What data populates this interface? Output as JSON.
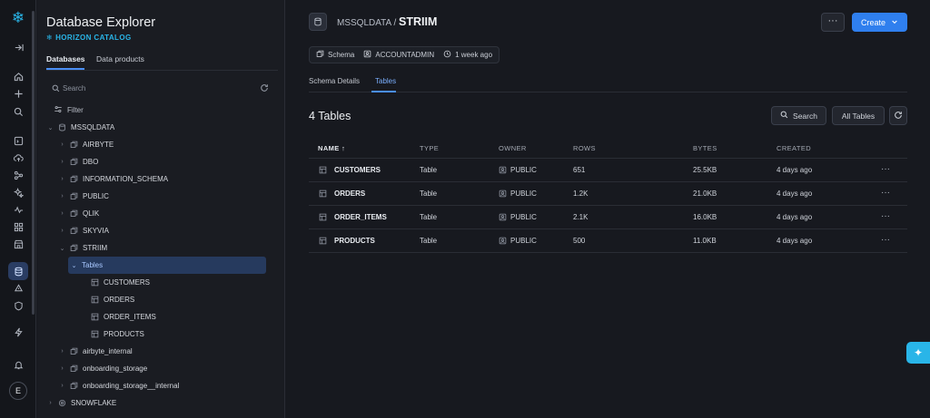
{
  "sidebar": {
    "title": "Database Explorer",
    "subtitle": "HORIZON CATALOG",
    "tabs": [
      "Databases",
      "Data products"
    ],
    "search_placeholder": "Search",
    "filter_label": "Filter",
    "tree": {
      "root": "MSSQLDATA",
      "schemas": [
        "AIRBYTE",
        "DBO",
        "INFORMATION_SCHEMA",
        "PUBLIC",
        "QLIK",
        "SKYVIA",
        "STRIIM"
      ],
      "tables_folder": "Tables",
      "tables": [
        "CUSTOMERS",
        "ORDERS",
        "ORDER_ITEMS",
        "PRODUCTS"
      ],
      "more_schemas": [
        "airbyte_internal",
        "onboarding_storage",
        "onboarding_storage__internal"
      ],
      "other_db": "SNOWFLAKE"
    }
  },
  "rail": {
    "avatar_initial": "E"
  },
  "header": {
    "db": "MSSQLDATA",
    "separator": "/",
    "schema": "STRIIM",
    "more_label": "···",
    "create_label": "Create"
  },
  "meta": {
    "type": "Schema",
    "owner": "ACCOUNTADMIN",
    "age": "1 week ago"
  },
  "tabs": [
    "Schema Details",
    "Tables"
  ],
  "table_section": {
    "count_title": "4 Tables",
    "search_label": "Search",
    "filter_label": "All Tables"
  },
  "columns": [
    "NAME",
    "TYPE",
    "OWNER",
    "ROWS",
    "BYTES",
    "CREATED"
  ],
  "rows": [
    {
      "name": "CUSTOMERS",
      "type": "Table",
      "owner": "PUBLIC",
      "rows": "651",
      "bytes": "25.5KB",
      "created": "4 days ago"
    },
    {
      "name": "ORDERS",
      "type": "Table",
      "owner": "PUBLIC",
      "rows": "1.2K",
      "bytes": "21.0KB",
      "created": "4 days ago"
    },
    {
      "name": "ORDER_ITEMS",
      "type": "Table",
      "owner": "PUBLIC",
      "rows": "2.1K",
      "bytes": "16.0KB",
      "created": "4 days ago"
    },
    {
      "name": "PRODUCTS",
      "type": "Table",
      "owner": "PUBLIC",
      "rows": "500",
      "bytes": "11.0KB",
      "created": "4 days ago"
    }
  ],
  "colors": {
    "accent": "#2f7fee",
    "brand": "#29b5e8",
    "selection": "#263a5e",
    "background": "#17191f"
  }
}
